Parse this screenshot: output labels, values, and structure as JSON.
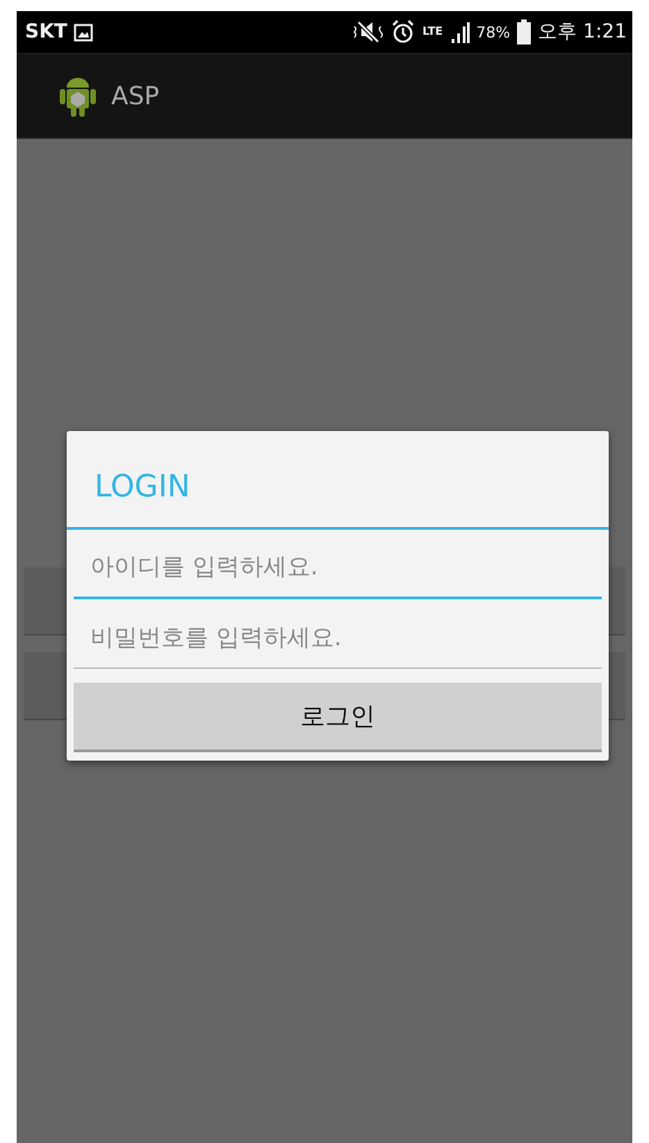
{
  "status_bar": {
    "carrier": "SKT",
    "network": "LTE",
    "battery": "78%",
    "time": "오후 1:21"
  },
  "action_bar": {
    "title": "ASP"
  },
  "background_buttons": [
    {
      "kind": "button"
    },
    {
      "kind": "button"
    }
  ],
  "dialog": {
    "title": "LOGIN",
    "fields": [
      {
        "placeholder": "아이디를 입력하세요.",
        "focused": true
      },
      {
        "placeholder": "비밀번호를 입력하세요.",
        "focused": false
      }
    ],
    "button": "로그인"
  }
}
